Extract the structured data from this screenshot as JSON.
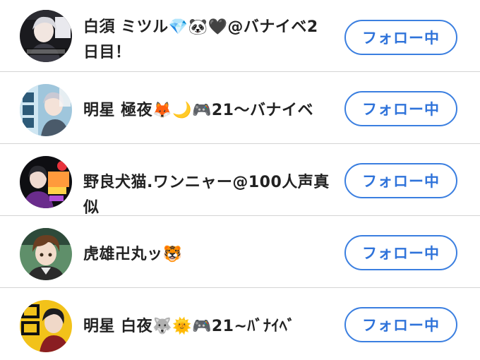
{
  "following_list": {
    "items": [
      {
        "name": "白須 ミツル💎🐼🖤@バナイベ2日目！",
        "button_label": "フォロー中",
        "avatar_icon": "avatar-silver-hair-character"
      },
      {
        "name": "明星 極夜🦊🌙🎮21～バナイベ",
        "button_label": "フォロー中",
        "avatar_icon": "avatar-zatsudan-character"
      },
      {
        "name": "野良犬猫.ワンニャー@100人声真似",
        "button_label": "フォロー中",
        "avatar_icon": "avatar-dark-colorful-character"
      },
      {
        "name": "虎雄卍丸ッ🐯",
        "button_label": "フォロー中",
        "avatar_icon": "avatar-brown-hair-character"
      },
      {
        "name": "明星 白夜🐺🌞🎮21~ﾊﾞﾅｲﾍﾞ",
        "button_label": "フォロー中",
        "avatar_icon": "avatar-zatsudan-yellow-character"
      }
    ]
  },
  "colors": {
    "accent": "#3b7fe0",
    "divider": "#d4d4d4",
    "text": "#222222",
    "background": "#ffffff"
  }
}
